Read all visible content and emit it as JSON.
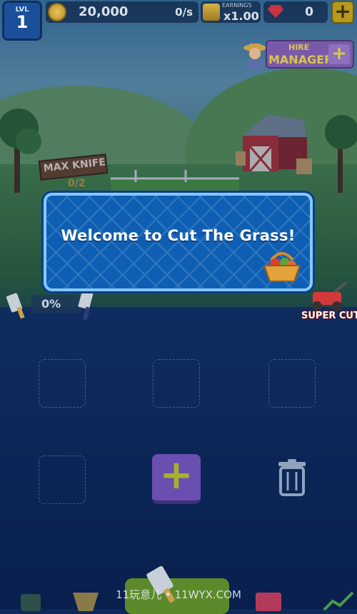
{
  "hud": {
    "level_label": "LVL",
    "level_value": "1",
    "coins": "20,000",
    "coin_rate": "0/s",
    "earnings_label": "EARNINGS",
    "earnings_value": "x1.00",
    "gems": "0",
    "add_gems_label": "+"
  },
  "hire_manager": {
    "line1": "HIRE",
    "line2": "MANAGER",
    "plus": "+"
  },
  "field_sign": {
    "title": "MAX KNIFE",
    "count": "0/2"
  },
  "progress": {
    "percent": "0%"
  },
  "super_cut": {
    "label": "SUPER CUT"
  },
  "merge_grid": {
    "add_label": "+"
  },
  "dialog": {
    "message": "Welcome to Cut The Grass!"
  },
  "watermark": "11玩意儿 • 11WYX.COM",
  "icons": [
    "coin-icon",
    "earnings-icon",
    "gem-icon",
    "farmer-icon",
    "knife-icon",
    "supercut-mower-icon",
    "trash-icon",
    "basket-icon"
  ],
  "colors": {
    "dialog_bg": "#0e5fb3",
    "dialog_border": "#86c8ff",
    "add_button": "#6a4fb0",
    "gold": "#d8c64a"
  }
}
